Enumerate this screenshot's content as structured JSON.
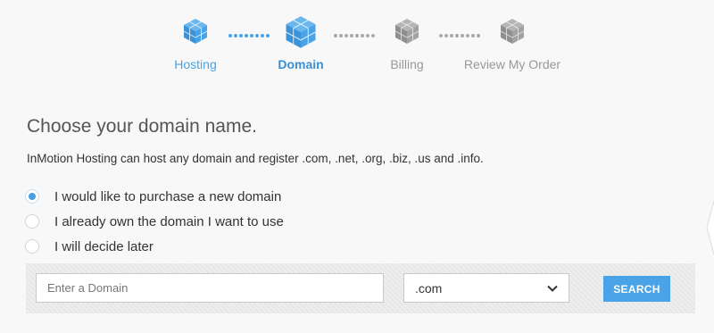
{
  "colors": {
    "active": "#4aa3e6",
    "inactive": "#999999",
    "accent_radio": "#4a9de0"
  },
  "steps": [
    {
      "label": "Hosting",
      "state": "done",
      "icon": "cube-icon"
    },
    {
      "label": "Domain",
      "state": "current",
      "icon": "cube-icon"
    },
    {
      "label": "Billing",
      "state": "pending",
      "icon": "cube-icon"
    },
    {
      "label": "Review My Order",
      "state": "pending",
      "icon": "cube-icon"
    }
  ],
  "main": {
    "title": "Choose your domain name.",
    "description": "InMotion Hosting can host any domain and register .com, .net, .org, .biz, .us and .info.",
    "options": [
      {
        "label": "I would like to purchase a new domain",
        "checked": true
      },
      {
        "label": "I already own the domain I want to use",
        "checked": false
      },
      {
        "label": "I will decide later",
        "checked": false
      }
    ]
  },
  "search": {
    "placeholder": "Enter a Domain",
    "value": "",
    "tld_selected": ".com",
    "button_label": "SEARCH"
  }
}
